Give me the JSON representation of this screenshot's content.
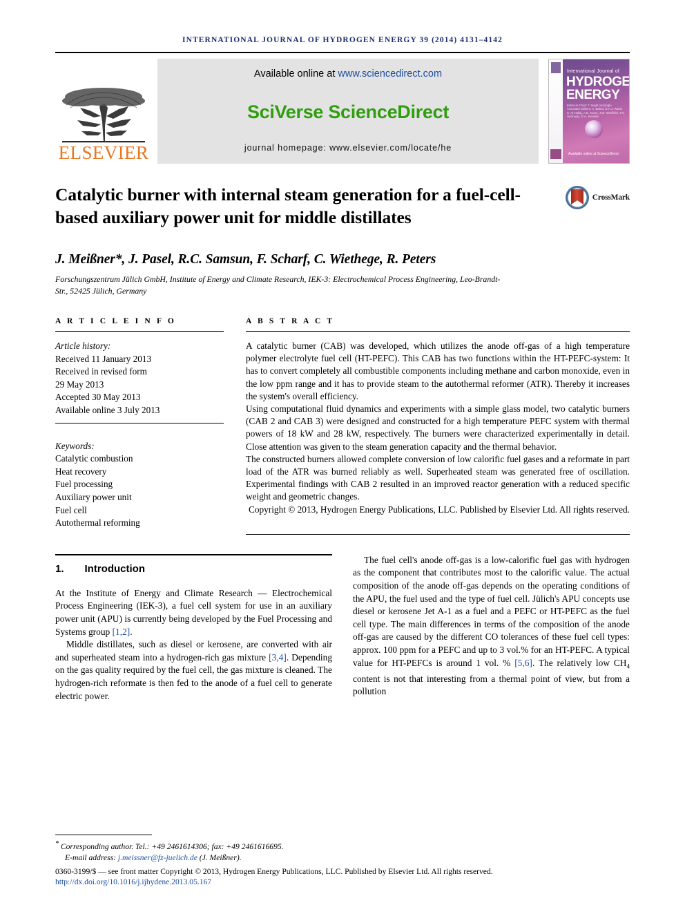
{
  "running_head": "INTERNATIONAL JOURNAL OF HYDROGEN ENERGY 39 (2014) 4131–4142",
  "masthead": {
    "publisher_name": "ELSEVIER",
    "available_online_prefix": "Available online at ",
    "sciencedirect_url": "www.sciencedirect.com",
    "sciverse_logo": "SciVerse ScienceDirect",
    "journal_homepage": "journal homepage: www.elsevier.com/locate/he",
    "cover": {
      "line_small": "International Journal of",
      "line_1": "HYDROGEN",
      "line_2": "ENERGY",
      "editors": "Editor-in-Chief: T. Nejat Veziroglu    Associate Editors: A. Bahar, D.A.J. Rand, S. Al-Hallaj, A.E. Kocer, J.W. Sheffield, T.N. Veziroglu, D.A. Svenkle",
      "sciencedirect_mark": "Available online at\nScienceDirect"
    }
  },
  "article": {
    "title": "Catalytic burner with internal steam generation for a fuel-cell-based auxiliary power unit for middle distillates",
    "crossmark_label": "CrossMark",
    "authors": "J. Meißner*, J. Pasel, R.C. Samsun, F. Scharf, C. Wiethege, R. Peters",
    "affiliation": "Forschungszentrum Jülich GmbH, Institute of Energy and Climate Research, IEK-3: Electrochemical Process Engineering, Leo-Brandt-Str., 52425 Jülich, Germany"
  },
  "article_info": {
    "heading": "A R T I C L E   I N F O",
    "history_label": "Article history:",
    "history": [
      "Received 11 January 2013",
      "Received in revised form",
      "29 May 2013",
      "Accepted 30 May 2013",
      "Available online 3 July 2013"
    ],
    "keywords_label": "Keywords:",
    "keywords": [
      "Catalytic combustion",
      "Heat recovery",
      "Fuel processing",
      "Auxiliary power unit",
      "Fuel cell",
      "Autothermal reforming"
    ]
  },
  "abstract": {
    "heading": "A B S T R A C T",
    "paragraphs": [
      "A catalytic burner (CAB) was developed, which utilizes the anode off-gas of a high temperature polymer electrolyte fuel cell (HT-PEFC). This CAB has two functions within the HT-PEFC-system: It has to convert completely all combustible components including methane and carbon monoxide, even in the low ppm range and it has to provide steam to the autothermal reformer (ATR). Thereby it increases the system's overall efficiency.",
      "Using computational fluid dynamics and experiments with a simple glass model, two catalytic burners (CAB 2 and CAB 3) were designed and constructed for a high temperature PEFC system with thermal powers of 18 kW and 28 kW, respectively. The burners were characterized experimentally in detail. Close attention was given to the steam generation capacity and the thermal behavior.",
      "The constructed burners allowed complete conversion of low calorific fuel gases and a reformate in part load of the ATR was burned reliably as well. Superheated steam was generated free of oscillation. Experimental findings with CAB 2 resulted in an improved reactor generation with a reduced specific weight and geometric changes."
    ],
    "copyright": "Copyright © 2013, Hydrogen Energy Publications, LLC. Published by Elsevier Ltd. All rights reserved."
  },
  "introduction": {
    "number": "1.",
    "title": "Introduction",
    "left_paragraphs": [
      {
        "indent": false,
        "segments": [
          {
            "text": "At the Institute of Energy and Climate Research — Electrochemical Process Engineering (IEK-3), a fuel cell system for use in an auxiliary power unit (APU) is currently being developed by the Fuel Processing and Systems group "
          },
          {
            "text": "[1,2]",
            "ref": true
          },
          {
            "text": "."
          }
        ]
      },
      {
        "indent": true,
        "segments": [
          {
            "text": "Middle distillates, such as diesel or kerosene, are converted with air and superheated steam into a hydrogen-rich gas mixture "
          },
          {
            "text": "[3,4]",
            "ref": true
          },
          {
            "text": ". Depending on the gas quality required by the fuel cell, the gas mixture is cleaned. The hydrogen-rich reformate is then fed to the anode of a fuel cell to generate electric power."
          }
        ]
      }
    ],
    "right_paragraphs": [
      {
        "indent": true,
        "segments": [
          {
            "text": "The fuel cell's anode off-gas is a low-calorific fuel gas with hydrogen as the component that contributes most to the calorific value. The actual composition of the anode off-gas depends on the operating conditions of the APU, the fuel used and the type of fuel cell. Jülich's APU concepts use diesel or kerosene Jet A-1 as a fuel and a PEFC or HT-PEFC as the fuel cell type. The main differences in terms of the composition of the anode off-gas are caused by the different CO tolerances of these fuel cell types: approx. 100 ppm for a PEFC and up to 3 vol.% for an HT-PEFC. A typical value for HT-PEFCs is around 1 vol. % "
          },
          {
            "text": "[5,6]",
            "ref": true
          },
          {
            "text": ". The relatively low CH"
          },
          {
            "text": "4",
            "sub": true
          },
          {
            "text": " content is not that interesting from a thermal point of view, but from a pollution"
          }
        ]
      }
    ]
  },
  "footnotes": {
    "corresponding_star": "*",
    "corresponding_author": "Corresponding author. Tel.: +49 2461614306; fax: +49 2461616695.",
    "email_label": "E-mail address: ",
    "email": "j.meissner@fz-juelich.de",
    "email_suffix": " (J. Meißner).",
    "issn_copyright": "0360-3199/$ — see front matter Copyright © 2013, Hydrogen Energy Publications, LLC. Published by Elsevier Ltd. All rights reserved.",
    "doi": "http://dx.doi.org/10.1016/j.ijhydene.2013.05.167"
  },
  "colors": {
    "elsevier_orange": "#e87722",
    "sciverse_green": "#2f9e0e",
    "link_blue": "#1d4fa0",
    "running_head_blue": "#1a2f6e",
    "banner_grey": "#e3e3e3"
  }
}
